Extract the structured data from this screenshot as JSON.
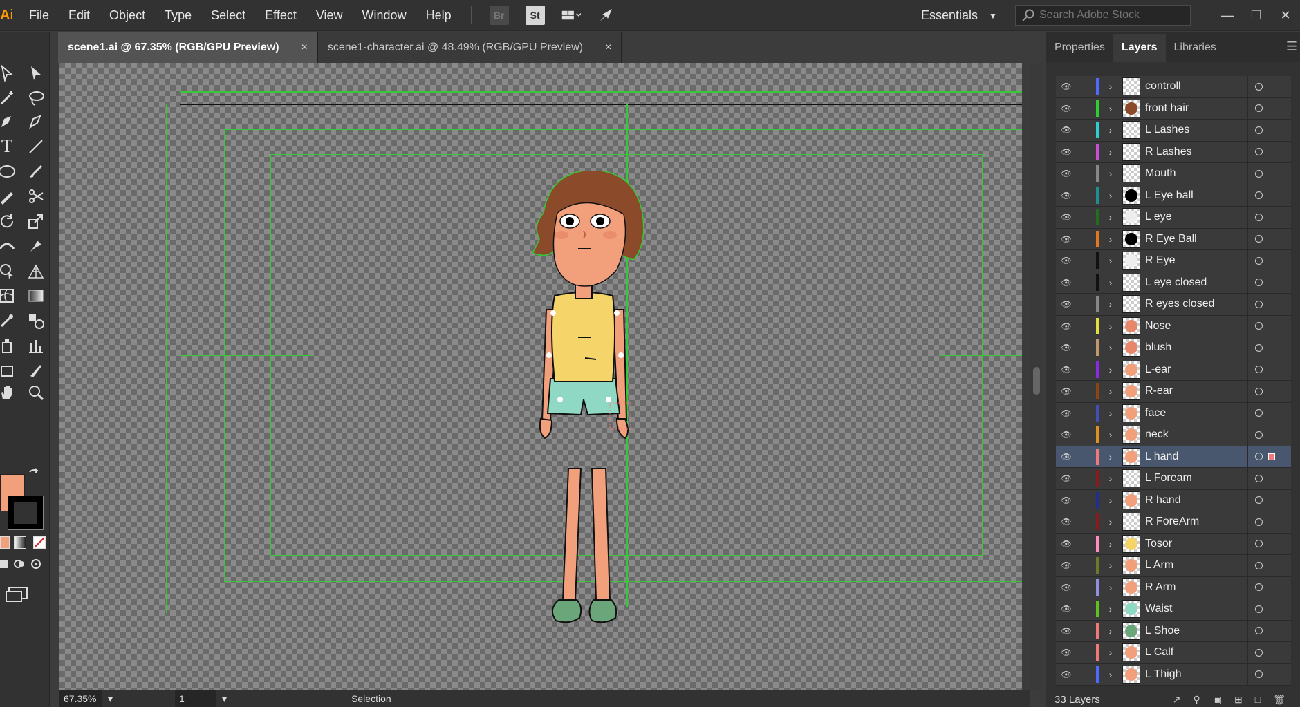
{
  "menubar": {
    "logo": "Ai",
    "items": [
      "File",
      "Edit",
      "Object",
      "Type",
      "Select",
      "Effect",
      "View",
      "Window",
      "Help"
    ],
    "bridge_label": "Br",
    "stock_label": "St",
    "workspace": "Essentials",
    "search_placeholder": "Search Adobe Stock"
  },
  "tabs": [
    {
      "title": "scene1.ai @ 67.35% (RGB/GPU Preview)",
      "close": "×"
    },
    {
      "title": "scene1-character.ai @ 48.49% (RGB/GPU Preview)",
      "close": "×"
    }
  ],
  "status": {
    "zoom": "67.35%",
    "page": "1",
    "mode": "Selection"
  },
  "panel": {
    "tabs": [
      "Properties",
      "Layers",
      "Libraries"
    ],
    "active_tab": "Layers",
    "layer_count": "33 Layers",
    "layers": [
      {
        "name": "controll",
        "color": "#4f6bff",
        "thumb": "checker"
      },
      {
        "name": "front hair",
        "color": "#2fcf2f",
        "thumb": "#8b4a2a"
      },
      {
        "name": "L Lashes",
        "color": "#2fcfcf",
        "thumb": "checker"
      },
      {
        "name": "R Lashes",
        "color": "#c94fd8",
        "thumb": "checker"
      },
      {
        "name": "Mouth",
        "color": "#888888",
        "thumb": "checker"
      },
      {
        "name": "L Eye ball",
        "color": "#1f8f8f",
        "thumb": "#000000"
      },
      {
        "name": "L eye",
        "color": "#1f6f1f",
        "thumb": "#eeeeee"
      },
      {
        "name": "R Eye Ball",
        "color": "#e07a20",
        "thumb": "#000000"
      },
      {
        "name": "R Eye",
        "color": "#111111",
        "thumb": "#eeeeee"
      },
      {
        "name": "L eye closed",
        "color": "#111111",
        "thumb": "checker"
      },
      {
        "name": "R eyes closed",
        "color": "#888888",
        "thumb": "checker"
      },
      {
        "name": "Nose",
        "color": "#e0e040",
        "thumb": "#e8876a"
      },
      {
        "name": "blush",
        "color": "#c09870",
        "thumb": "#e8876a"
      },
      {
        "name": "L-ear",
        "color": "#8a2be2",
        "thumb": "#f2a07b"
      },
      {
        "name": "R-ear",
        "color": "#8b4513",
        "thumb": "#f2a07b"
      },
      {
        "name": "face",
        "color": "#3f51b5",
        "thumb": "#f2a07b"
      },
      {
        "name": "neck",
        "color": "#e09020",
        "thumb": "#f2a07b"
      },
      {
        "name": "L hand",
        "color": "#f07a7a",
        "thumb": "#f2a07b",
        "selected": true
      },
      {
        "name": "L Foream",
        "color": "#8b1a1a",
        "thumb": "checker"
      },
      {
        "name": "R hand",
        "color": "#1f2f8f",
        "thumb": "#f2a07b"
      },
      {
        "name": "R ForeArm",
        "color": "#8b1a1a",
        "thumb": "checker"
      },
      {
        "name": "Tosor",
        "color": "#ff8fc0",
        "thumb": "#f5d46a"
      },
      {
        "name": "L Arm",
        "color": "#6b7a2a",
        "thumb": "#f2a07b"
      },
      {
        "name": "R Arm",
        "color": "#9090e0",
        "thumb": "#f2a07b"
      },
      {
        "name": "Waist",
        "color": "#60c020",
        "thumb": "#8fd9c4"
      },
      {
        "name": "L Shoe",
        "color": "#f07a7a",
        "thumb": "#6aa67a"
      },
      {
        "name": "L Calf",
        "color": "#f07a7a",
        "thumb": "#f2a07b"
      },
      {
        "name": "L Thigh",
        "color": "#4f6bff",
        "thumb": "#f2a07b"
      }
    ]
  },
  "toolbar": {
    "fill_color": "#f2a07b",
    "stroke_color": "#000000"
  }
}
